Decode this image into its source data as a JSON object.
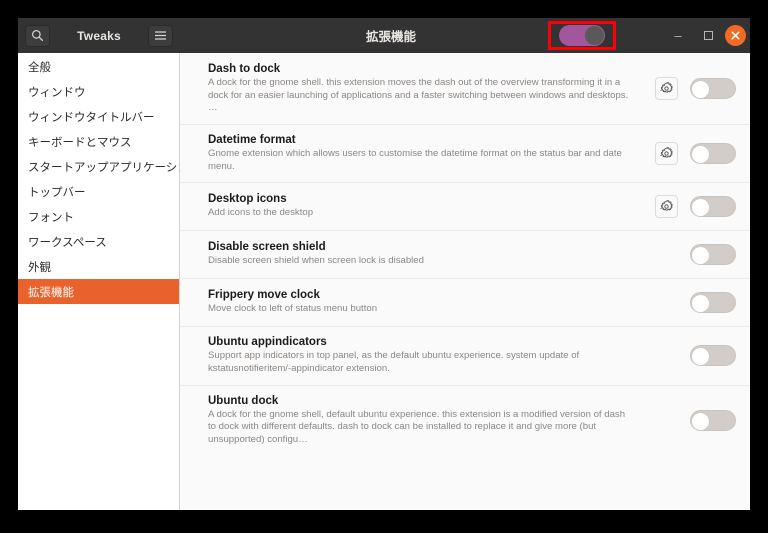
{
  "window": {
    "app_title": "Tweaks",
    "page_title": "拡張機能",
    "search_icon": "search-icon",
    "menu_icon": "hamburger-menu-icon",
    "master_switch_state": "on",
    "annotation_color": "#fb0007",
    "accent_color": "#e9622b",
    "switch_on_color": "#a2569c",
    "controls": {
      "minimize_label": "–",
      "maximize_label": "□",
      "close_label": "×"
    }
  },
  "sidebar": {
    "items": [
      {
        "label": "全般",
        "selected": false
      },
      {
        "label": "ウィンドウ",
        "selected": false
      },
      {
        "label": "ウィンドウタイトルバー",
        "selected": false
      },
      {
        "label": "キーボードとマウス",
        "selected": false
      },
      {
        "label": "スタートアップアプリケーション",
        "selected": false
      },
      {
        "label": "トップバー",
        "selected": false
      },
      {
        "label": "フォント",
        "selected": false
      },
      {
        "label": "ワークスペース",
        "selected": false
      },
      {
        "label": "外観",
        "selected": false
      },
      {
        "label": "拡張機能",
        "selected": true
      }
    ]
  },
  "extensions": [
    {
      "name": "Dash to dock",
      "description": "A dock for the gnome shell. this extension moves the dash out of the overview transforming it in a dock for an easier launching of applications and a faster switching between windows and desktops. …",
      "has_settings": true,
      "settings_icon": "gear-icon",
      "enabled": false
    },
    {
      "name": "Datetime format",
      "description": "Gnome extension which allows users to customise the datetime format on the status bar and date menu.",
      "has_settings": true,
      "settings_icon": "gear-icon",
      "enabled": false
    },
    {
      "name": "Desktop icons",
      "description": "Add icons to the desktop",
      "has_settings": true,
      "settings_icon": "gear-icon",
      "enabled": false
    },
    {
      "name": "Disable screen shield",
      "description": "Disable screen shield when screen lock is disabled",
      "has_settings": false,
      "settings_icon": "",
      "enabled": false
    },
    {
      "name": "Frippery move clock",
      "description": "Move clock to left of status menu button",
      "has_settings": false,
      "settings_icon": "",
      "enabled": false
    },
    {
      "name": "Ubuntu appindicators",
      "description": "Support app indicators in top panel, as the default ubuntu experience. system update of kstatusnotifieritem/-appindicator extension.",
      "has_settings": false,
      "settings_icon": "",
      "enabled": false
    },
    {
      "name": "Ubuntu dock",
      "description": "A dock for the gnome shell, default ubuntu experience. this extension is a modified version of dash to dock with different defaults. dash to dock can be installed to replace it and give more (but unsupported) configu…",
      "has_settings": false,
      "settings_icon": "",
      "enabled": false
    }
  ]
}
